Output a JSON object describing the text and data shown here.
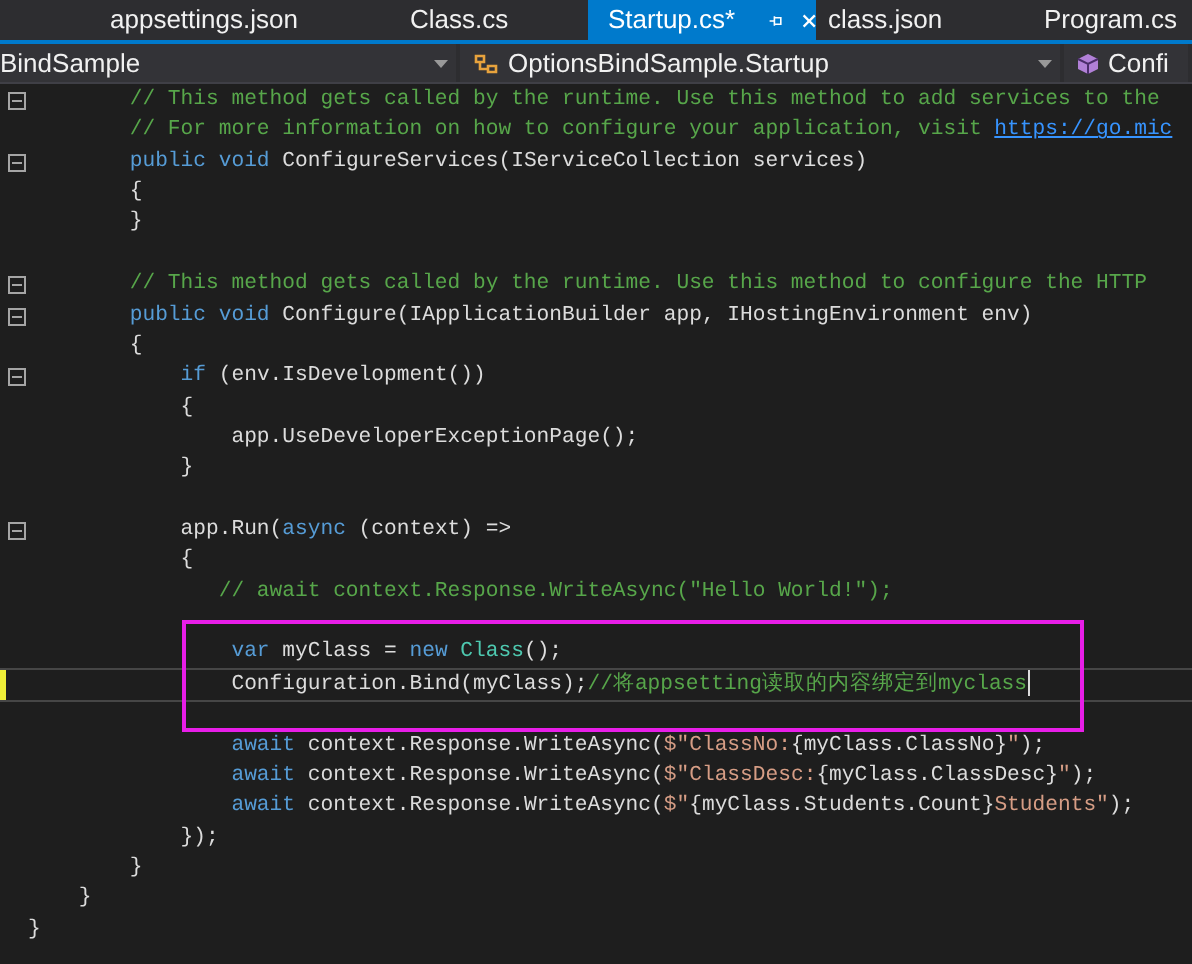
{
  "tabs": [
    {
      "label": "appsettings.json",
      "selected": false
    },
    {
      "label": "Class.cs",
      "selected": false
    },
    {
      "label": "Startup.cs*",
      "selected": true
    },
    {
      "label": "class.json",
      "selected": false
    },
    {
      "label": "Program.cs",
      "selected": false
    }
  ],
  "navigation_bar": [
    {
      "kind": "project",
      "label": "BindSample"
    },
    {
      "kind": "class",
      "label": "OptionsBindSample.Startup"
    },
    {
      "kind": "method",
      "label": "Confi"
    }
  ],
  "code_lines": [
    {
      "collapsible": true,
      "tokens": [
        {
          "kind": "comment",
          "text": "        // This method gets called by the runtime. Use this method to add services to the"
        }
      ]
    },
    {
      "tokens": [
        {
          "kind": "comment",
          "text": "        // For more information on how to configure your application, visit "
        },
        {
          "kind": "link",
          "text": "https://go.mic"
        }
      ]
    },
    {
      "collapsible": true,
      "tokens": [
        {
          "kind": "keyword",
          "text": "        public void"
        },
        {
          "kind": "plain",
          "text": " ConfigureServices(IServiceCollection services)"
        }
      ]
    },
    {
      "tokens": [
        {
          "kind": "plain",
          "text": "        {"
        }
      ]
    },
    {
      "tokens": [
        {
          "kind": "plain",
          "text": "        }"
        }
      ]
    },
    {
      "kind": "blank"
    },
    {
      "collapsible": true,
      "tokens": [
        {
          "kind": "comment",
          "text": "        // This method gets called by the runtime. Use this method to configure the HTTP"
        }
      ]
    },
    {
      "collapsible": true,
      "tokens": [
        {
          "kind": "keyword",
          "text": "        public void"
        },
        {
          "kind": "plain",
          "text": " Configure(IApplicationBuilder app, IHostingEnvironment env)"
        }
      ]
    },
    {
      "tokens": [
        {
          "kind": "plain",
          "text": "        {"
        }
      ]
    },
    {
      "collapsible": true,
      "tokens": [
        {
          "kind": "keyword",
          "text": "            if"
        },
        {
          "kind": "plain",
          "text": " (env.IsDevelopment())"
        }
      ]
    },
    {
      "tokens": [
        {
          "kind": "plain",
          "text": "            {"
        }
      ]
    },
    {
      "tokens": [
        {
          "kind": "plain",
          "text": "                app.UseDeveloperExceptionPage();"
        }
      ]
    },
    {
      "tokens": [
        {
          "kind": "plain",
          "text": "            }"
        }
      ]
    },
    {
      "kind": "blank"
    },
    {
      "collapsible": true,
      "tokens": [
        {
          "kind": "plain",
          "text": "            app.Run("
        },
        {
          "kind": "keyword",
          "text": "async"
        },
        {
          "kind": "plain",
          "text": " (context) =>"
        }
      ]
    },
    {
      "tokens": [
        {
          "kind": "plain",
          "text": "            {"
        }
      ]
    },
    {
      "tokens": [
        {
          "kind": "comment",
          "text": "               // await context.Response.WriteAsync(\"Hello World!\");"
        }
      ]
    },
    {
      "kind": "blank"
    },
    {
      "boxed": true,
      "tokens": [
        {
          "kind": "keyword",
          "text": "                var"
        },
        {
          "kind": "plain",
          "text": " myClass = "
        },
        {
          "kind": "keyword",
          "text": "new"
        },
        {
          "kind": "type",
          "text": " Class"
        },
        {
          "kind": "plain",
          "text": "();"
        }
      ]
    },
    {
      "boxed": true,
      "current": true,
      "modified": true,
      "tokens": [
        {
          "kind": "plain",
          "text": "                Configuration.Bind(myClass);"
        },
        {
          "kind": "comment",
          "text": "//将appsetting读取的内容绑定到myclass"
        }
      ]
    },
    {
      "kind": "blank",
      "boxed": true
    },
    {
      "tokens": [
        {
          "kind": "keyword",
          "text": "                await"
        },
        {
          "kind": "plain",
          "text": " context.Response.WriteAsync("
        },
        {
          "kind": "string",
          "text": "$\"ClassNo:"
        },
        {
          "kind": "plain",
          "text": "{myClass.ClassNo}"
        },
        {
          "kind": "string",
          "text": "\""
        },
        {
          "kind": "plain",
          "text": ");"
        }
      ]
    },
    {
      "tokens": [
        {
          "kind": "keyword",
          "text": "                await"
        },
        {
          "kind": "plain",
          "text": " context.Response.WriteAsync("
        },
        {
          "kind": "string",
          "text": "$\"ClassDesc:"
        },
        {
          "kind": "plain",
          "text": "{myClass.ClassDesc}"
        },
        {
          "kind": "string",
          "text": "\""
        },
        {
          "kind": "plain",
          "text": ");"
        }
      ]
    },
    {
      "tokens": [
        {
          "kind": "keyword",
          "text": "                await"
        },
        {
          "kind": "plain",
          "text": " context.Response.WriteAsync("
        },
        {
          "kind": "string",
          "text": "$\""
        },
        {
          "kind": "plain",
          "text": "{myClass.Students.Count}"
        },
        {
          "kind": "string",
          "text": "Students\""
        },
        {
          "kind": "plain",
          "text": ");"
        }
      ]
    },
    {
      "tokens": [
        {
          "kind": "plain",
          "text": "            });"
        }
      ]
    },
    {
      "tokens": [
        {
          "kind": "plain",
          "text": "        }"
        }
      ]
    },
    {
      "tokens": [
        {
          "kind": "plain",
          "text": "    }"
        }
      ]
    },
    {
      "tokens": [
        {
          "kind": "plain",
          "text": "}"
        }
      ]
    }
  ]
}
